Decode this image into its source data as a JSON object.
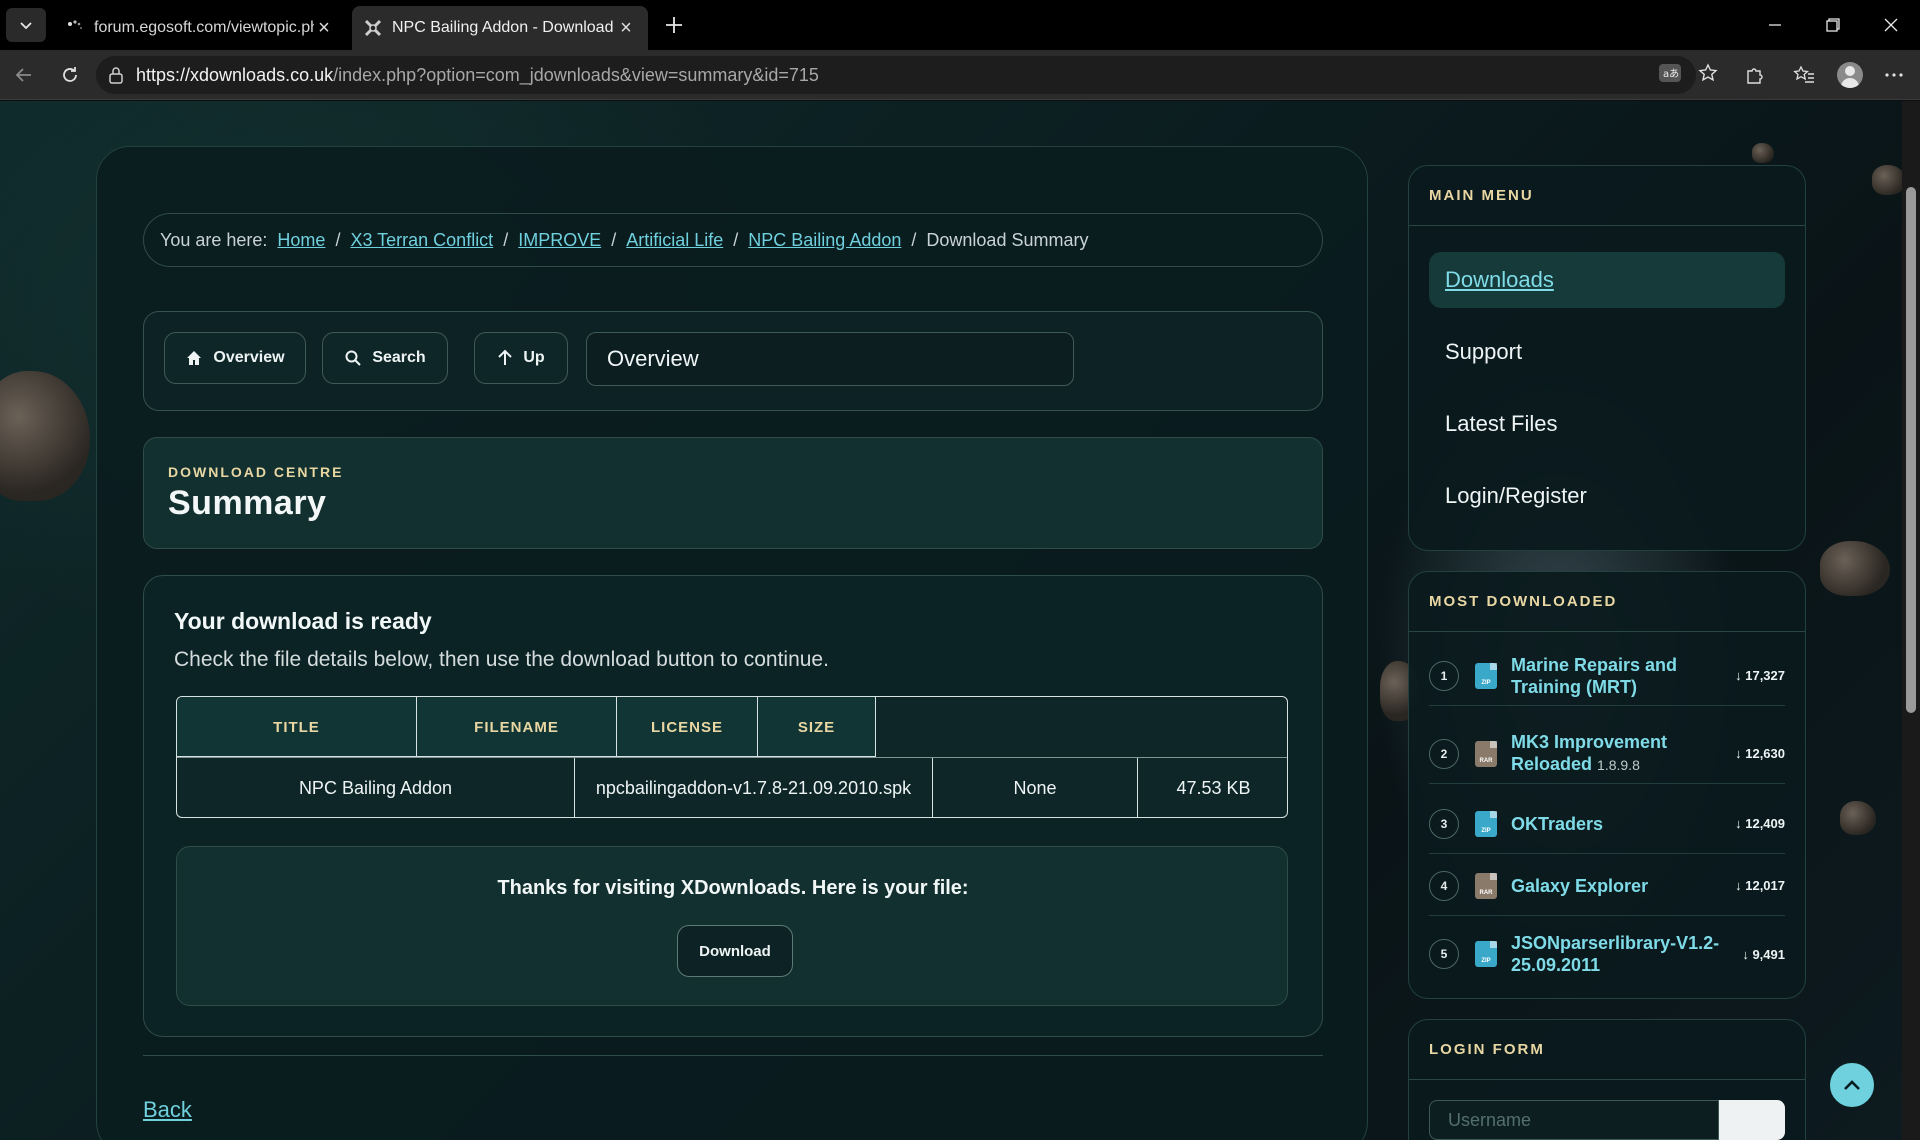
{
  "browser": {
    "tabs": [
      {
        "title": "forum.egosoft.com/viewtopic.php?",
        "active": false
      },
      {
        "title": "NPC Bailing Addon - Download Su",
        "active": true
      }
    ],
    "url_host": "https://xdownloads.co.uk",
    "url_path": "/index.php?option=com_jdownloads&view=summary&id=715"
  },
  "breadcrumb": {
    "prefix": "You are here:",
    "links": [
      "Home",
      "X3 Terran Conflict",
      "IMPROVE",
      "Artificial Life",
      "NPC Bailing Addon"
    ],
    "current": "Download Summary"
  },
  "toolbar": {
    "overview_label": "Overview",
    "search_label": "Search",
    "up_label": "Up",
    "select_value": "Overview"
  },
  "header": {
    "kicker": "DOWNLOAD CENTRE",
    "title": "Summary"
  },
  "ready": {
    "heading": "Your download is ready",
    "subtitle": "Check the file details below, then use the download button to continue.",
    "columns": [
      "TITLE",
      "FILENAME",
      "LICENSE",
      "SIZE"
    ],
    "row": {
      "title": "NPC Bailing Addon",
      "filename": "npcbailingaddon-v1.7.8-21.09.2010.spk",
      "license": "None",
      "size": "47.53 KB"
    },
    "thanks": "Thanks for visiting XDownloads. Here is your file:",
    "download_label": "Download"
  },
  "back_label": "Back",
  "main_menu": {
    "heading": "MAIN MENU",
    "items": [
      "Downloads",
      "Support",
      "Latest Files",
      "Login/Register"
    ],
    "active": "Downloads"
  },
  "most_downloaded": {
    "heading": "MOST DOWNLOADED",
    "items": [
      {
        "rank": "1",
        "name": "Marine Repairs and Training (MRT)",
        "version": "",
        "count": "↓ 17,327",
        "ext": "ZIP"
      },
      {
        "rank": "2",
        "name": "MK3 Improvement Reloaded",
        "version": "1.8.9.8",
        "count": "↓ 12,630",
        "ext": "RAR"
      },
      {
        "rank": "3",
        "name": "OKTraders",
        "version": "",
        "count": "↓ 12,409",
        "ext": "ZIP"
      },
      {
        "rank": "4",
        "name": "Galaxy Explorer",
        "version": "",
        "count": "↓ 12,017",
        "ext": "RAR"
      },
      {
        "rank": "5",
        "name": "JSONparserlibrary-V1.2-25.09.2011",
        "version": "",
        "count": "↓ 9,491",
        "ext": "ZIP"
      }
    ]
  },
  "login_form": {
    "heading": "LOGIN FORM",
    "username_placeholder": "Username"
  },
  "colors": {
    "accent": "#6fd0de",
    "gold": "#e9d7a3",
    "panel": "#0c2326",
    "zip_icon": "#3aa9c9",
    "rar_icon": "#8a7a6a"
  }
}
